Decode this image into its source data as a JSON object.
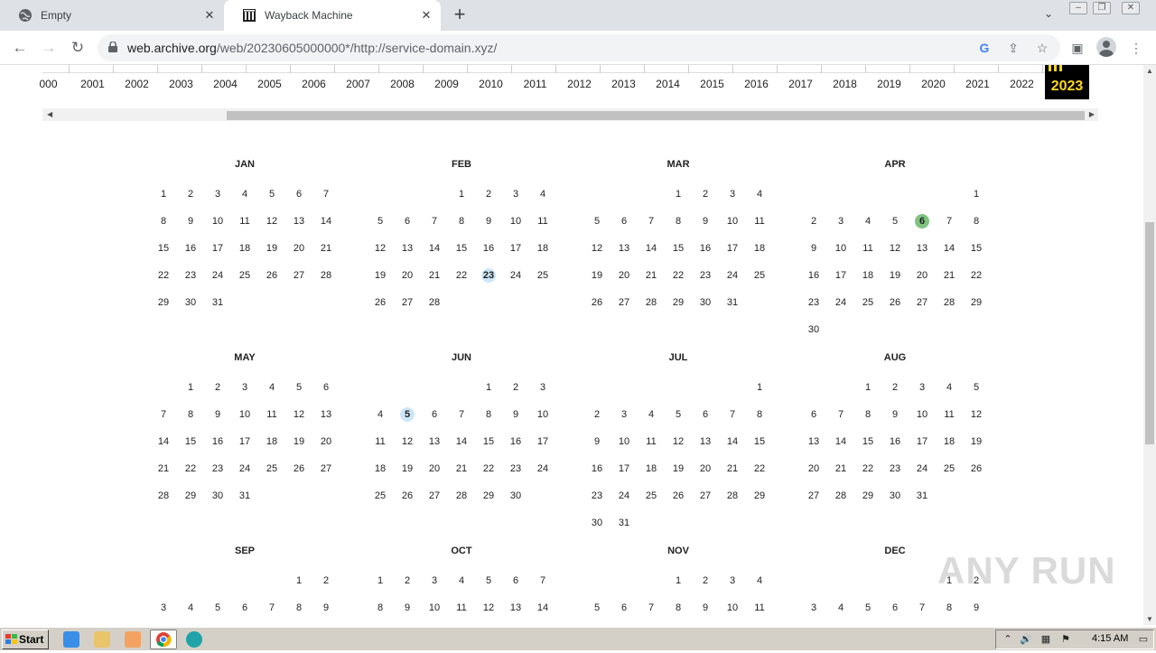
{
  "tabs": [
    {
      "title": "Empty",
      "icon": "globe-icon"
    },
    {
      "title": "Wayback Machine",
      "icon": "archive-icon"
    }
  ],
  "address": {
    "host": "web.archive.org",
    "path": "/web/20230605000000*/http://service-domain.xyz/"
  },
  "years": [
    "000",
    "2001",
    "2002",
    "2003",
    "2004",
    "2005",
    "2006",
    "2007",
    "2008",
    "2009",
    "2010",
    "2011",
    "2012",
    "2013",
    "2014",
    "2015",
    "2016",
    "2017",
    "2018",
    "2019",
    "2020",
    "2021",
    "2022",
    "2023"
  ],
  "selected_year": "2023",
  "months": [
    {
      "name": "JAN",
      "start": 0,
      "days": 31,
      "captures": []
    },
    {
      "name": "FEB",
      "start": 3,
      "days": 28,
      "captures": [
        23
      ]
    },
    {
      "name": "MAR",
      "start": 3,
      "days": 31,
      "captures": []
    },
    {
      "name": "APR",
      "start": 6,
      "days": 30,
      "captures": [
        6
      ]
    },
    {
      "name": "MAY",
      "start": 1,
      "days": 31,
      "captures": []
    },
    {
      "name": "JUN",
      "start": 4,
      "days": 30,
      "captures": [
        5
      ]
    },
    {
      "name": "JUL",
      "start": 6,
      "days": 31,
      "captures": []
    },
    {
      "name": "AUG",
      "start": 2,
      "days": 31,
      "captures": []
    },
    {
      "name": "SEP",
      "start": 5,
      "days": 9,
      "captures": []
    },
    {
      "name": "OCT",
      "start": 0,
      "days": 14,
      "captures": []
    },
    {
      "name": "NOV",
      "start": 3,
      "days": 11,
      "captures": []
    },
    {
      "name": "DEC",
      "start": 5,
      "days": 9,
      "captures": []
    }
  ],
  "capture_colors": {
    "FEB-23": "#cde6f7",
    "APR-6": "#7fc37f",
    "JUN-5": "#cde6f7"
  },
  "watermark": "ANY RUN",
  "taskbar": {
    "start_label": "Start",
    "clock": "4:15 AM"
  }
}
